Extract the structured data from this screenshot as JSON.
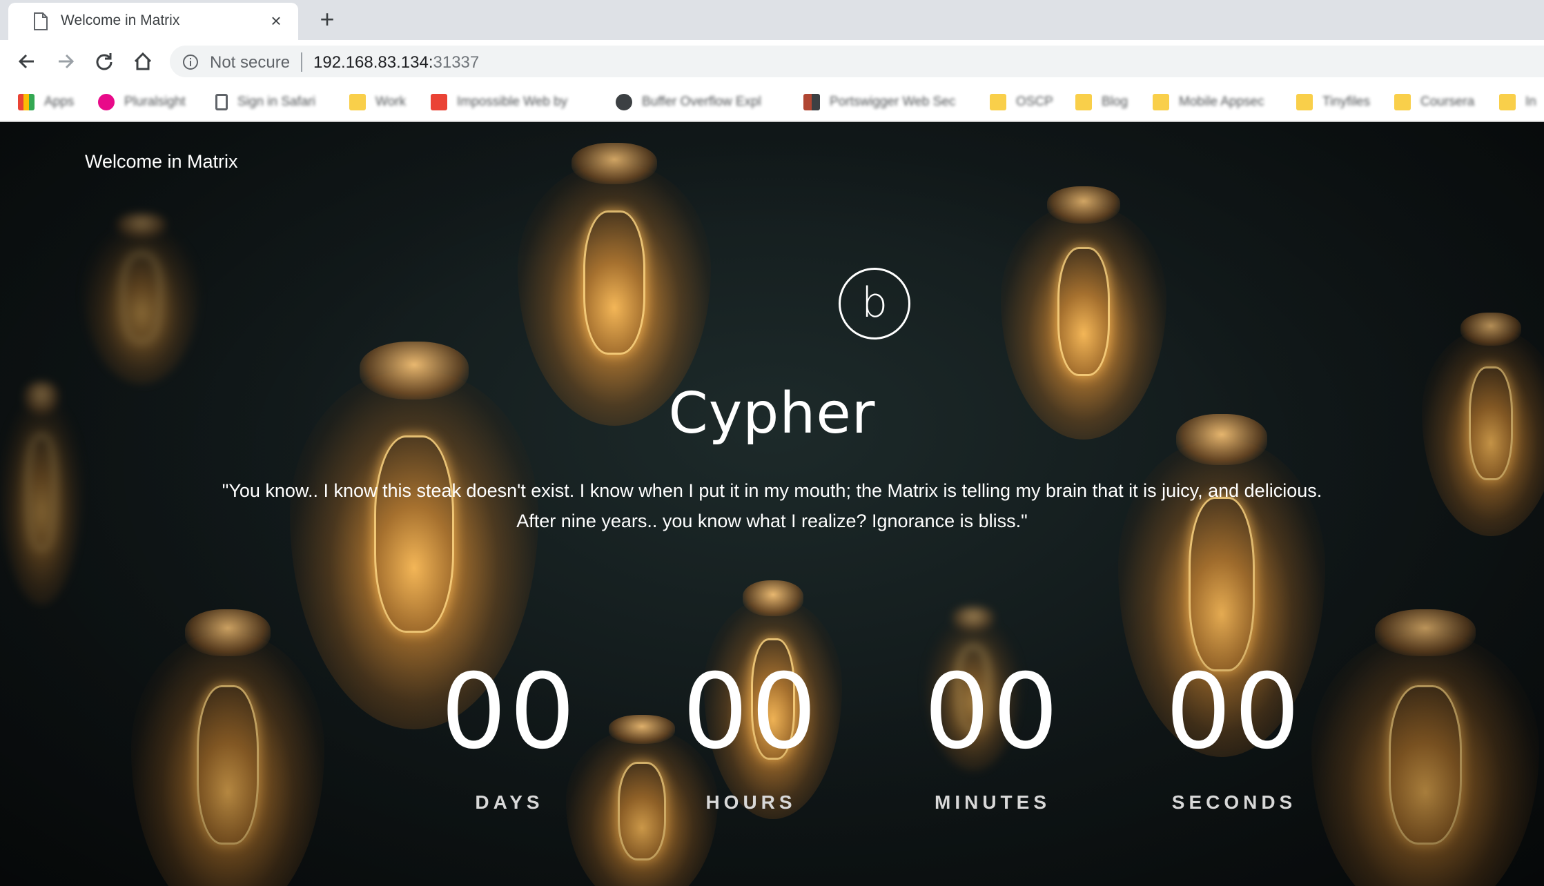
{
  "browser": {
    "tab": {
      "title": "Welcome in Matrix",
      "close_glyph": "×"
    },
    "new_tab_glyph": "+",
    "omnibox": {
      "security_label": "Not secure",
      "url_host": "192.168.83.134:",
      "url_port": "31337"
    },
    "bookmarks": [
      {
        "label": "Apps",
        "color": "#4285f4"
      },
      {
        "label": "Pluralsight",
        "color": "#e80a89"
      },
      {
        "label": "Sign in Safari",
        "color": "#5f6368"
      },
      {
        "label": "Work",
        "color": "#f9cf4a"
      },
      {
        "label": "Impossible Web by",
        "color": "#ea4335"
      },
      {
        "label": "Buffer Overflow Expl",
        "color": "#3c4043"
      },
      {
        "label": "Portswigger Web Sec",
        "color": "#b04632"
      },
      {
        "label": "OSCP",
        "color": "#f9cf4a"
      },
      {
        "label": "Blog",
        "color": "#f9cf4a"
      },
      {
        "label": "Mobile Appsec",
        "color": "#f9cf4a"
      },
      {
        "label": "Tinyfiles",
        "color": "#f9cf4a"
      },
      {
        "label": "Coursera",
        "color": "#f9cf4a"
      },
      {
        "label": "In",
        "color": "#f9cf4a"
      }
    ]
  },
  "page": {
    "brand": "Welcome in Matrix",
    "logo_letter": "b",
    "heading": "Cypher",
    "quote_line1": "\"You know.. I know this steak doesn't exist. I know when I put it in my mouth; the Matrix is telling my brain that it is juicy, and delicious.",
    "quote_line2": "After nine years.. you know what I realize? Ignorance is bliss.\"",
    "countdown": [
      {
        "value": "00",
        "label": "DAYS"
      },
      {
        "value": "00",
        "label": "HOURS"
      },
      {
        "value": "00",
        "label": "MINUTES"
      },
      {
        "value": "00",
        "label": "SECONDS"
      }
    ]
  }
}
